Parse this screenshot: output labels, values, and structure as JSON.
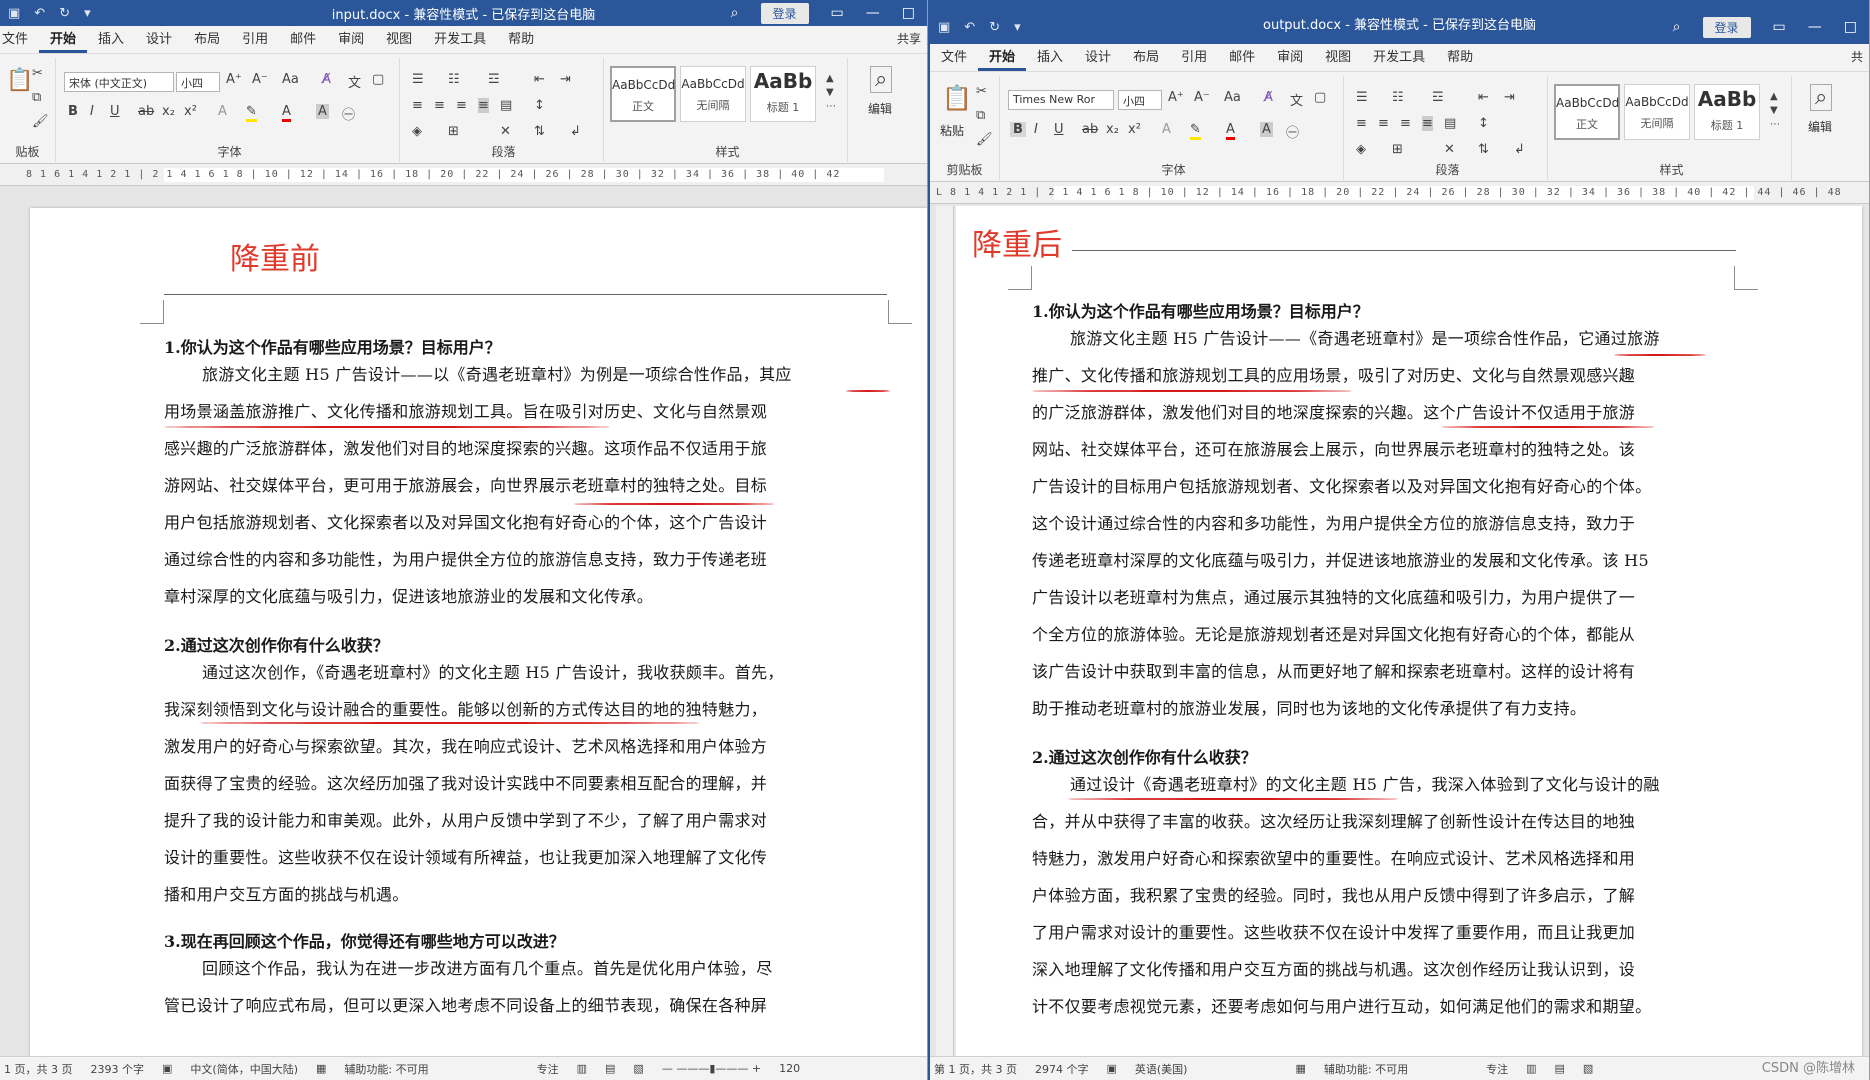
{
  "left_window": {
    "title": "input.docx - 兼容性模式 - 已保存到这台电脑",
    "login": "登录",
    "tabs": [
      "文件",
      "开始",
      "插入",
      "设计",
      "布局",
      "引用",
      "邮件",
      "审阅",
      "视图",
      "开发工具",
      "帮助"
    ],
    "active_tab": "开始",
    "share": "共享",
    "font_name": "宋体 (中文正文)",
    "font_size": "小四",
    "group_labels": {
      "clipboard": "贴板",
      "font": "字体",
      "paragraph": "段落",
      "styles": "样式"
    },
    "styles": [
      {
        "preview": "AaBbCcDd",
        "name": "正文"
      },
      {
        "preview": "AaBbCcDd",
        "name": "无间隔"
      },
      {
        "preview": "AaBb",
        "name": "标题 1"
      }
    ],
    "edit_label": "编辑",
    "ruler_text": "8 1 6 1 4 1 2 1 | 2 1 4 1 6 1 8 | 10 | 12 | 14 | 16 | 18 | 20 | 22 | 24 | 26 | 28 | 30 | 32 | 34 | 36 | 38 | 40 | 42",
    "doc_title": "降重前",
    "q1": "1.你认为这个作品有哪些应用场景？目标用户？",
    "p1": [
      "旅游文化主题 H5 广告设计——以《奇遇老班章村》为例是一项综合性作品，其应",
      "用场景涵盖旅游推广、文化传播和旅游规划工具。旨在吸引对历史、文化与自然景观",
      "感兴趣的广泛旅游群体，激发他们对目的地深度探索的兴趣。这项作品不仅适用于旅",
      "游网站、社交媒体平台，更可用于旅游展会，向世界展示老班章村的独特之处。目标",
      "用户包括旅游规划者、文化探索者以及对异国文化抱有好奇心的个体，这个广告设计",
      "通过综合性的内容和多功能性，为用户提供全方位的旅游信息支持，致力于传递老班",
      "章村深厚的文化底蕴与吸引力，促进该地旅游业的发展和文化传承。"
    ],
    "q2": "2.通过这次创作你有什么收获？",
    "p2": [
      "通过这次创作，《奇遇老班章村》的文化主题 H5 广告设计，我收获颇丰。首先，",
      "我深刻领悟到文化与设计融合的重要性。能够以创新的方式传达目的地的独特魅力，",
      "激发用户的好奇心与探索欲望。其次，我在响应式设计、艺术风格选择和用户体验方",
      "面获得了宝贵的经验。这次经历加强了我对设计实践中不同要素相互配合的理解，并",
      "提升了我的设计能力和审美观。此外，从用户反馈中学到了不少，了解了用户需求对",
      "设计的重要性。这些收获不仅在设计领域有所裨益，也让我更加深入地理解了文化传",
      "播和用户交互方面的挑战与机遇。"
    ],
    "q3": "3.现在再回顾这个作品，你觉得还有哪些地方可以改进？",
    "p3": [
      "回顾这个作品，我认为在进一步改进方面有几个重点。首先是优化用户体验，尽",
      "管已设计了响应式布局，但可以更深入地考虑不同设备上的细节表现，确保在各种屏"
    ],
    "status": {
      "page": "1 页，共 3 页",
      "words": "2393 个字",
      "language": "中文(简体，中国大陆)",
      "accessibility": "辅助功能: 不可用",
      "focus": "专注",
      "zoom": "120"
    }
  },
  "right_window": {
    "title": "output.docx - 兼容性模式 - 已保存到这台电脑",
    "login": "登录",
    "tabs": [
      "文件",
      "开始",
      "插入",
      "设计",
      "布局",
      "引用",
      "邮件",
      "审阅",
      "视图",
      "开发工具",
      "帮助"
    ],
    "active_tab": "开始",
    "share": "共",
    "font_name": "Times New Ror",
    "font_size": "小四",
    "group_labels": {
      "clipboard": "剪贴板",
      "font": "字体",
      "paragraph": "段落",
      "styles": "样式"
    },
    "paste_label": "粘贴",
    "styles": [
      {
        "preview": "AaBbCcDd",
        "name": "正文"
      },
      {
        "preview": "AaBbCcDd",
        "name": "无间隔"
      },
      {
        "preview": "AaBb",
        "name": "标题 1"
      }
    ],
    "edit_label": "编辑",
    "ruler_text": "L 8 1 4 1 2 1 | 2 1 4 1 6 1 8 | 10 | 12 | 14 | 16 | 18 | 20 | 22 | 24 | 26 | 28 | 30 | 32 | 34 | 36 | 38 | 40 | 42 | 44 | 46 | 48",
    "doc_title": "降重后",
    "q1": "1.你认为这个作品有哪些应用场景？目标用户？",
    "p1": [
      "旅游文化主题 H5 广告设计——《奇遇老班章村》是一项综合性作品，它通过旅游",
      "推广、文化传播和旅游规划工具的应用场景，吸引了对历史、文化与自然景观感兴趣",
      "的广泛旅游群体，激发他们对目的地深度探索的兴趣。这个广告设计不仅适用于旅游",
      "网站、社交媒体平台，还可在旅游展会上展示，向世界展示老班章村的独特之处。该",
      "广告设计的目标用户包括旅游规划者、文化探索者以及对异国文化抱有好奇心的个体。",
      "这个设计通过综合性的内容和多功能性，为用户提供全方位的旅游信息支持，致力于",
      "传递老班章村深厚的文化底蕴与吸引力，并促进该地旅游业的发展和文化传承。该 H5",
      "广告设计以老班章村为焦点，通过展示其独特的文化底蕴和吸引力，为用户提供了一",
      "个全方位的旅游体验。无论是旅游规划者还是对异国文化抱有好奇心的个体，都能从",
      "该广告设计中获取到丰富的信息，从而更好地了解和探索老班章村。这样的设计将有",
      "助于推动老班章村的旅游业发展，同时也为该地的文化传承提供了有力支持。"
    ],
    "q2": "2.通过这次创作你有什么收获？",
    "p2": [
      "通过设计《奇遇老班章村》的文化主题 H5 广告，我深入体验到了文化与设计的融",
      "合，并从中获得了丰富的收获。这次经历让我深刻理解了创新性设计在传达目的地独",
      "特魅力，激发用户好奇心和探索欲望中的重要性。在响应式设计、艺术风格选择和用",
      "户体验方面，我积累了宝贵的经验。同时，我也从用户反馈中得到了许多启示，了解",
      "了用户需求对设计的重要性。这些收获不仅在设计中发挥了重要作用，而且让我更加",
      "深入地理解了文化传播和用户交互方面的挑战与机遇。这次创作经历让我认识到，设",
      "计不仅要考虑视觉元素，还要考虑如何与用户进行互动，如何满足他们的需求和期望。"
    ],
    "status": {
      "page": "第 1 页，共 3 页",
      "words": "2974 个字",
      "language": "英语(美国)",
      "accessibility": "辅助功能: 不可用",
      "focus": "专注"
    }
  },
  "watermark": "CSDN @陈增林",
  "colors": {
    "titlebar": "#2b579a",
    "doc_title": "#e03a2a",
    "red_mark": "#d61b1b"
  }
}
